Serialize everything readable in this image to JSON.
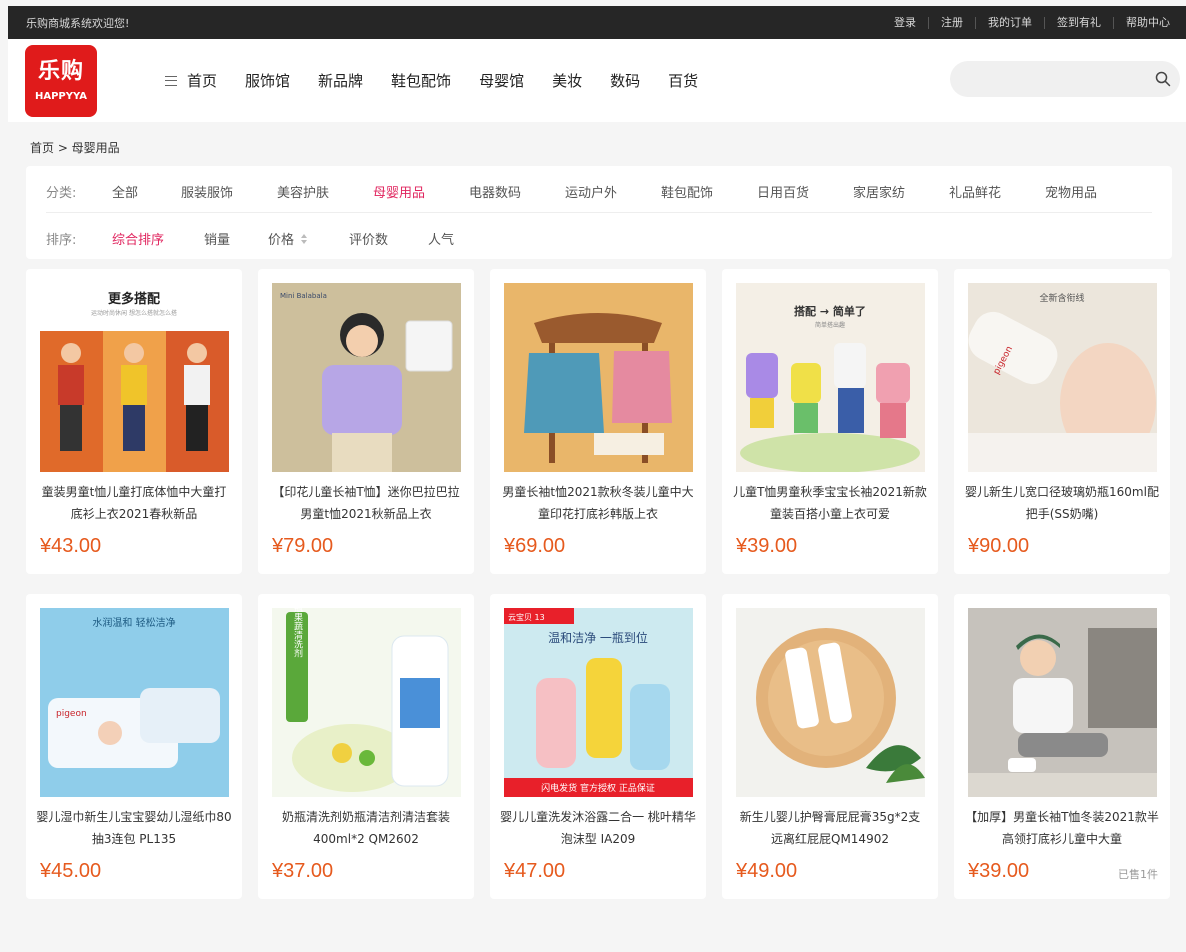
{
  "topbar": {
    "welcome": "乐购商城系统欢迎您!",
    "links": [
      "登录",
      "注册",
      "我的订单",
      "签到有礼",
      "帮助中心"
    ]
  },
  "logo": {
    "cn": "乐购",
    "en": "HAPPYYA"
  },
  "nav": [
    "首页",
    "服饰馆",
    "新品牌",
    "鞋包配饰",
    "母婴馆",
    "美妆",
    "数码",
    "百货"
  ],
  "search": {
    "placeholder": ""
  },
  "breadcrumb": "首页 > 母婴用品",
  "filter": {
    "category_label": "分类:",
    "categories": [
      "全部",
      "服装服饰",
      "美容护肤",
      "母婴用品",
      "电器数码",
      "运动户外",
      "鞋包配饰",
      "日用百货",
      "家居家纺",
      "礼品鲜花",
      "宠物用品"
    ],
    "active_category": "母婴用品",
    "sort_label": "排序:",
    "sorts": [
      "综合排序",
      "销量",
      "价格",
      "评价数",
      "人气"
    ],
    "active_sort": "综合排序"
  },
  "products": [
    {
      "title": "童装男童t恤儿童打底体恤中大童打底衫上衣2021春秋新品",
      "price": "¥43.00",
      "sold": "",
      "img_headline": "更多搭配",
      "img_sub": "运动时尚休闲 想怎么搭就怎么搭",
      "badge": ""
    },
    {
      "title": "【印花儿童长袖T恤】迷你巴拉巴拉男童t恤2021秋新品上衣",
      "price": "¥79.00",
      "sold": "",
      "img_headline": "",
      "img_sub": "",
      "badge": "Mini Balabala"
    },
    {
      "title": "男童长袖t恤2021款秋冬装儿童中大童印花打底衫韩版上衣",
      "price": "¥69.00",
      "sold": "",
      "img_headline": "",
      "img_sub": "",
      "badge": ""
    },
    {
      "title": "儿童T恤男童秋季宝宝长袖2021新款童装百搭小童上衣可爱",
      "price": "¥39.00",
      "sold": "",
      "img_headline": "搭配 → 简单了",
      "img_sub": "简单搭出趣",
      "badge": ""
    },
    {
      "title": "婴儿新生儿宽口径玻璃奶瓶160ml配把手(SS奶嘴)",
      "price": "¥90.00",
      "sold": "",
      "img_headline": "全新含衔线",
      "img_sub": "",
      "badge": "pigeon"
    },
    {
      "title": "婴儿湿巾新生儿宝宝婴幼儿湿纸巾80抽3连包 PL135",
      "price": "¥45.00",
      "sold": "",
      "img_headline": "水润温和  轻松洁净",
      "img_sub": "",
      "badge": "pigeon"
    },
    {
      "title": "奶瓶清洗剂奶瓶清洁剂清洁套装400ml*2 QM2602",
      "price": "¥37.00",
      "sold": "",
      "img_headline": "奶瓶果蔬清洗剂",
      "img_sub": "",
      "badge": ""
    },
    {
      "title": "婴儿儿童洗发沐浴露二合一 桃叶精华 泡沫型 IA209",
      "price": "¥47.00",
      "sold": "",
      "img_headline": "温和洁净 一瓶到位",
      "img_sub": "闪电发货  官方授权 正品保证",
      "badge": "云宝贝 13"
    },
    {
      "title": "新生儿婴儿护臀膏屁屁膏35g*2支 远离红屁屁QM14902",
      "price": "¥49.00",
      "sold": "",
      "img_headline": "",
      "img_sub": "",
      "badge": ""
    },
    {
      "title": "【加厚】男童长袖T恤冬装2021款半高领打底衫儿童中大童",
      "price": "¥39.00",
      "sold": "已售1件",
      "img_headline": "",
      "img_sub": "",
      "badge": ""
    }
  ],
  "colors": {
    "accent": "#e0245e",
    "price": "#e65a1e",
    "topbar": "#262626",
    "logo": "#e01b1b"
  }
}
